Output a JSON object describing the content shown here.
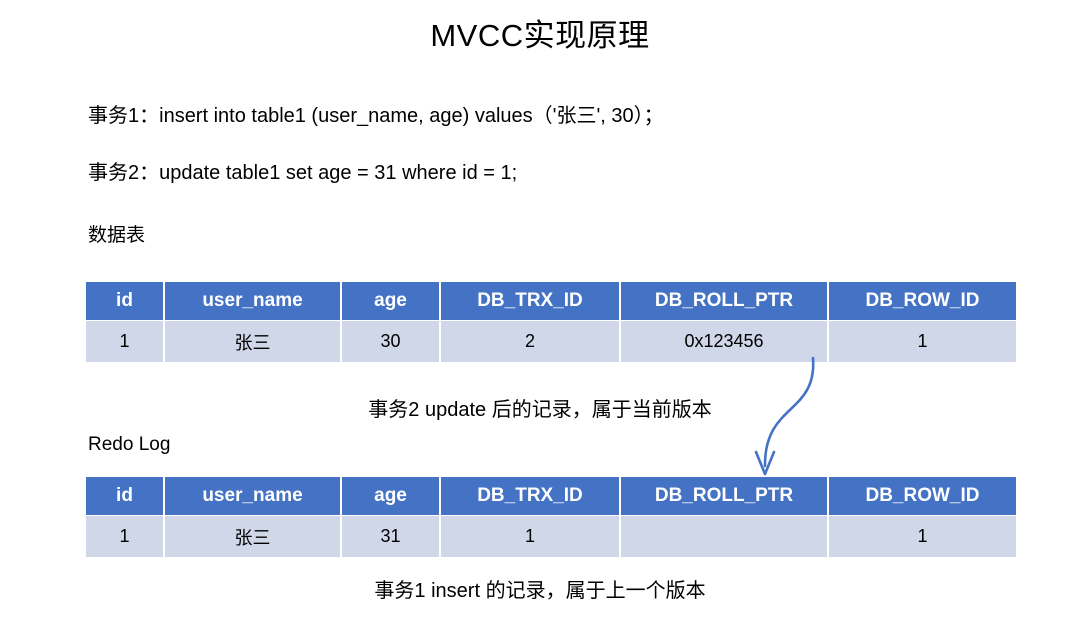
{
  "title": "MVCC实现原理",
  "statements": [
    {
      "id": "stmt-transaction-1",
      "text": "事务1：insert into table1 (user_name, age) values（'张三', 30）；"
    },
    {
      "id": "stmt-transaction-2",
      "text": "事务2：update table1 set  age = 31 where id = 1;"
    }
  ],
  "sections": {
    "data_table_label": "数据表",
    "redo_log_label": "Redo Log"
  },
  "columns": [
    "id",
    "user_name",
    "age",
    "DB_TRX_ID",
    "DB_ROLL_PTR",
    "DB_ROW_ID"
  ],
  "data_table": {
    "rows": [
      [
        "1",
        "张三",
        "30",
        "2",
        "0x123456",
        "1"
      ]
    ]
  },
  "redo_log_table": {
    "rows": [
      [
        "1",
        "张三",
        "31",
        "1",
        "",
        "1"
      ]
    ]
  },
  "captions": {
    "current_version": "事务2 update 后的记录，属于当前版本",
    "previous_version": "事务1 insert 的记录，属于上一个版本"
  },
  "colors": {
    "header_blue": "#4472C4",
    "row_light": "#D0D7E9",
    "arrow_blue": "#4472C4",
    "text_black": "#000000",
    "background": "#FFFFFF"
  },
  "arrow": {
    "name": "roll-pointer-arrow",
    "from_label": "DB_ROLL_PTR value 0x123456",
    "to_label": "Redo Log row"
  }
}
